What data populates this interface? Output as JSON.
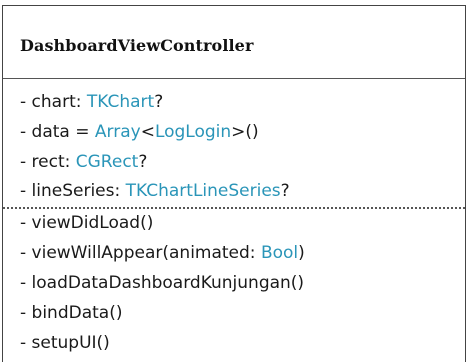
{
  "class_name": "DashboardViewController",
  "attributes": [
    {
      "prefix": "- chart: ",
      "type": "TKChart",
      "suffix": "?"
    },
    {
      "prefix": "- data = ",
      "type": "Array",
      "middle": "<",
      "type2": "LogLogin",
      "suffix": ">()"
    },
    {
      "prefix": "- rect: ",
      "type": "CGRect",
      "suffix": "?"
    },
    {
      "prefix": "- lineSeries: ",
      "type": "TKChartLineSeries",
      "suffix": "?"
    }
  ],
  "methods": [
    {
      "prefix": "- viewDidLoad()"
    },
    {
      "prefix": "- viewWillAppear(animated: ",
      "type": "Bool",
      "suffix": ")"
    },
    {
      "prefix": "- loadDataDashboardKunjungan()"
    },
    {
      "prefix": "- bindData()"
    },
    {
      "prefix": "- setupUI()"
    }
  ],
  "colors": {
    "type_highlight": "#2a95b8",
    "border": "#444444",
    "text": "#1a1a1a"
  }
}
